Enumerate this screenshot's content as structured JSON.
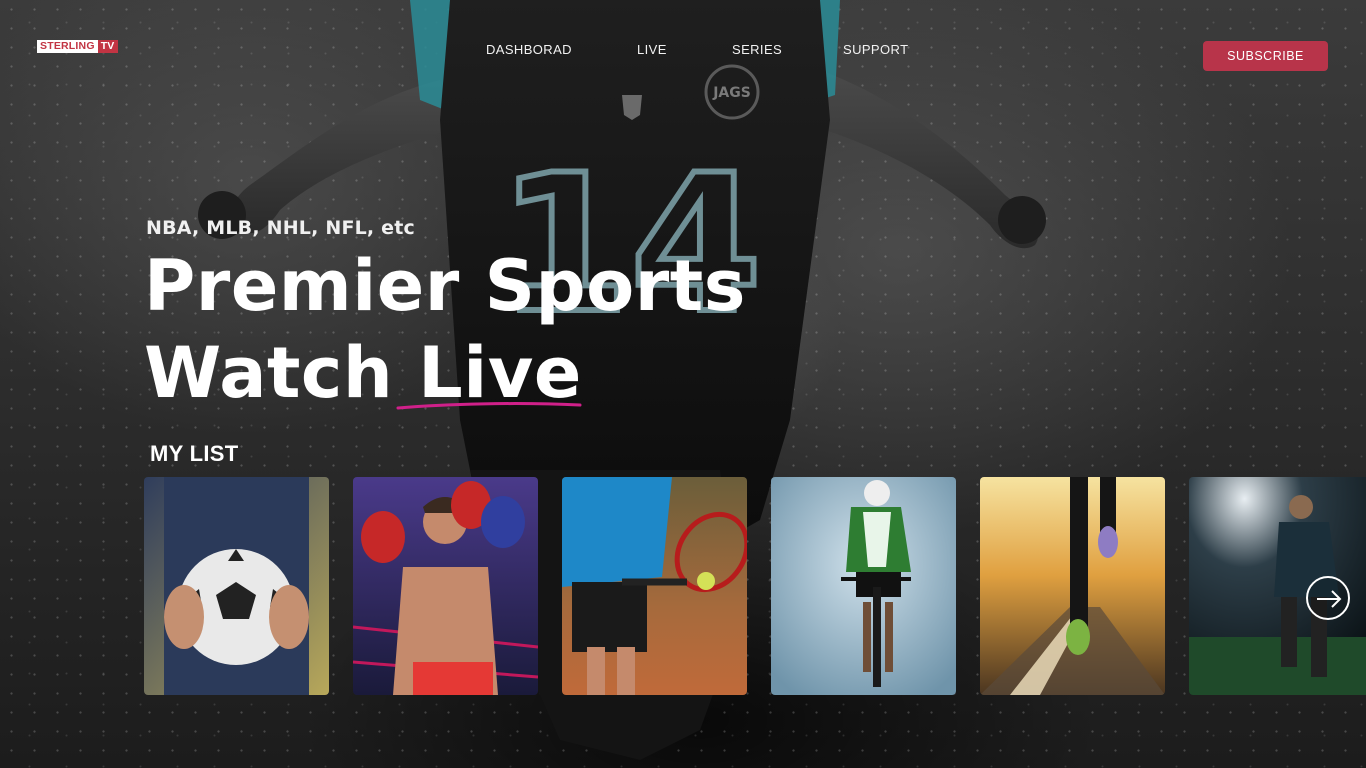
{
  "brand": {
    "name_part1": "STERLING",
    "name_part2": "TV"
  },
  "nav": {
    "items": [
      {
        "label": "DASHBORAD"
      },
      {
        "label": "LIVE"
      },
      {
        "label": "SERIES"
      },
      {
        "label": "SUPPORT"
      }
    ],
    "subscribe_label": "SUBSCRIBE"
  },
  "hero": {
    "eyebrow": "NBA, MLB, NHL, NFL, etc",
    "headline_line1": "Premier Sports",
    "headline_line2": "Watch Live",
    "jersey_number": "14",
    "jersey_team": "JAGS"
  },
  "my_list": {
    "title": "MY LIST",
    "cards": [
      {
        "sport": "soccer"
      },
      {
        "sport": "boxing"
      },
      {
        "sport": "tennis"
      },
      {
        "sport": "cycling"
      },
      {
        "sport": "running"
      },
      {
        "sport": "football-stadium"
      }
    ],
    "next_icon": "arrow-right-icon"
  },
  "colors": {
    "accent": "#b8344a",
    "underline": "#d0208a",
    "logo_red": "#c23443"
  }
}
